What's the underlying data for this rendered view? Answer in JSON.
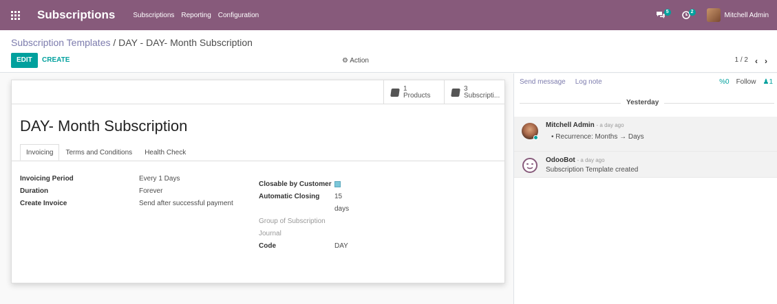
{
  "navbar": {
    "app_title": "Subscriptions",
    "menu": [
      "Subscriptions",
      "Reporting",
      "Configuration"
    ],
    "messages_count": "5",
    "activities_count": "2",
    "user_name": "Mitchell Admin",
    "brand_color": "#875a7b"
  },
  "control": {
    "breadcrumb_parent": "Subscription Templates",
    "breadcrumb_sep": " / ",
    "breadcrumb_current": "DAY - DAY- Month Subscription",
    "edit_label": "EDIT",
    "create_label": "CREATE",
    "action_label": "Action",
    "pager_value": "1 / 2",
    "prev_icon": "chevron-left-icon",
    "next_icon": "chevron-right-icon"
  },
  "sheet": {
    "stats": [
      {
        "count": "1",
        "label": "Products"
      },
      {
        "count": "3",
        "label": "Subscripti..."
      }
    ],
    "title": "DAY- Month Subscription",
    "tabs": [
      "Invoicing",
      "Terms and Conditions",
      "Health Check"
    ],
    "left_fields": [
      {
        "label": "Invoicing Period",
        "value": "Every 1 Days"
      },
      {
        "label": "Duration",
        "value": "Forever"
      },
      {
        "label": "Create Invoice",
        "value": "Send after successful payment"
      }
    ],
    "right_fields": {
      "closable_label": "Closable by Customer",
      "closable_checked": true,
      "auto_closing_label": "Automatic Closing",
      "auto_closing_value": "15",
      "auto_closing_unit": "days",
      "group_label": "Group of Subscription",
      "journal_label": "Journal",
      "code_label": "Code",
      "code_value": "DAY"
    }
  },
  "chatter": {
    "send_message": "Send message",
    "log_note": "Log note",
    "attachments_count": "0",
    "follow_label": "Follow",
    "followers_count": "1",
    "day_separator": "Yesterday",
    "messages": [
      {
        "author": "Mitchell Admin",
        "date": "- a day ago",
        "change_field": "Recurrence:",
        "change_old": "Months",
        "change_new": "Days"
      },
      {
        "author": "OdooBot",
        "date": "- a day ago",
        "text": "Subscription Template created"
      }
    ]
  }
}
